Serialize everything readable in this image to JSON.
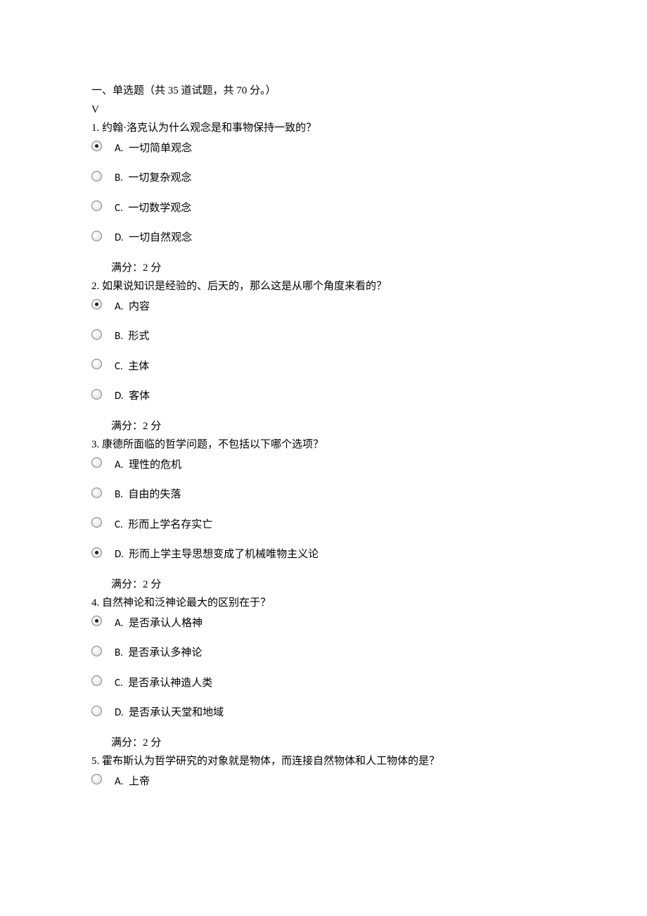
{
  "section": {
    "title": "一、单选题（共 35 道试题，共 70 分。）",
    "v": "V"
  },
  "score_text": "满分：2 分",
  "questions": [
    {
      "num": "1.",
      "text": "约翰·洛克认为什么观念是和事物保持一致的？",
      "selected": 0,
      "options": [
        {
          "letter": "A.",
          "text": "一切简单观念"
        },
        {
          "letter": "B.",
          "text": "一切复杂观念"
        },
        {
          "letter": "C.",
          "text": "一切数学观念"
        },
        {
          "letter": "D.",
          "text": "一切自然观念"
        }
      ]
    },
    {
      "num": "2.",
      "text": "如果说知识是经验的、后天的，那么这是从哪个角度来看的？",
      "selected": 0,
      "options": [
        {
          "letter": "A.",
          "text": "内容"
        },
        {
          "letter": "B.",
          "text": "形式"
        },
        {
          "letter": "C.",
          "text": "主体"
        },
        {
          "letter": "D.",
          "text": "客体"
        }
      ]
    },
    {
      "num": "3.",
      "text": "康德所面临的哲学问题，不包括以下哪个选项？",
      "selected": 3,
      "options": [
        {
          "letter": "A.",
          "text": "理性的危机"
        },
        {
          "letter": "B.",
          "text": "自由的失落"
        },
        {
          "letter": "C.",
          "text": "形而上学名存实亡"
        },
        {
          "letter": "D.",
          "text": "形而上学主导思想变成了机械唯物主义论"
        }
      ]
    },
    {
      "num": "4.",
      "text": "自然神论和泛神论最大的区别在于？",
      "selected": 0,
      "options": [
        {
          "letter": "A.",
          "text": "是否承认人格神"
        },
        {
          "letter": "B.",
          "text": "是否承认多神论"
        },
        {
          "letter": "C.",
          "text": "是否承认神造人类"
        },
        {
          "letter": "D.",
          "text": "是否承认天堂和地域"
        }
      ]
    },
    {
      "num": "5.",
      "text": "霍布斯认为哲学研究的对象就是物体，而连接自然物体和人工物体的是？",
      "selected": -1,
      "options": [
        {
          "letter": "A.",
          "text": "上帝"
        }
      ]
    }
  ]
}
